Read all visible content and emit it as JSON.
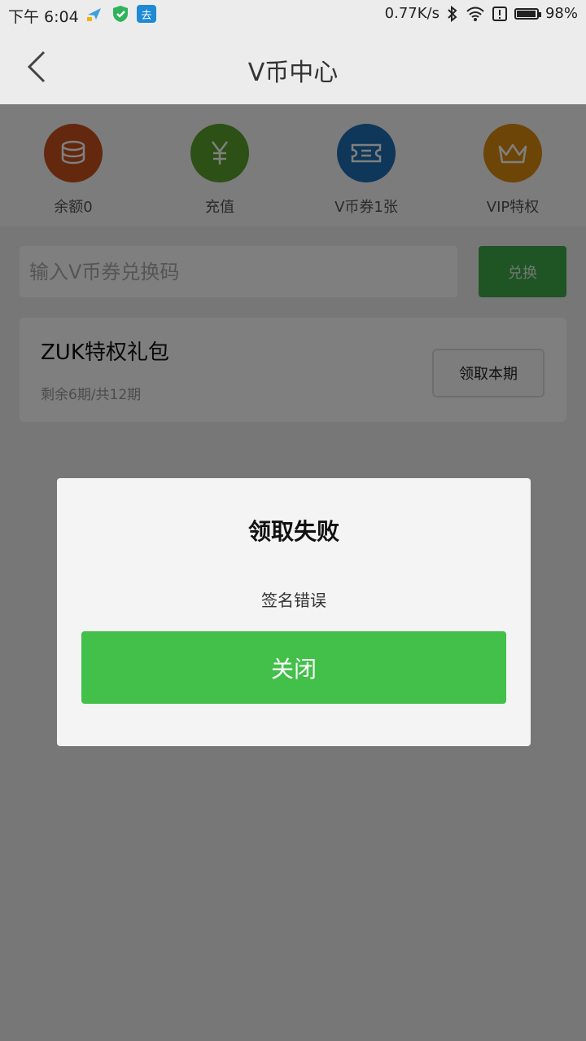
{
  "status_bar": {
    "time": "下午 6:04",
    "app_icon_label": "去",
    "network_speed": "0.77K/s",
    "battery_percent": "98%",
    "battery_level": 0.98
  },
  "nav": {
    "title": "V币中心"
  },
  "features": [
    {
      "label": "余额0",
      "icon": "coins-icon",
      "color": "#c6511a"
    },
    {
      "label": "充值",
      "icon": "yuan-icon",
      "color": "#59a12a"
    },
    {
      "label": "V币券1张",
      "icon": "ticket-icon",
      "color": "#1c6fb3"
    },
    {
      "label": "VIP特权",
      "icon": "crown-icon",
      "color": "#d98a0e"
    }
  ],
  "redeem": {
    "placeholder": "输入V币券兑换码",
    "button_label": "兑换"
  },
  "gift": {
    "title": "ZUK特权礼包",
    "subtitle": "剩余6期/共12期",
    "claim_label": "领取本期"
  },
  "dialog": {
    "title": "领取失败",
    "message": "签名错误",
    "close_label": "关闭"
  },
  "colors": {
    "accent_green": "#42c049",
    "overlay": "rgba(0,0,0,0.5)"
  }
}
